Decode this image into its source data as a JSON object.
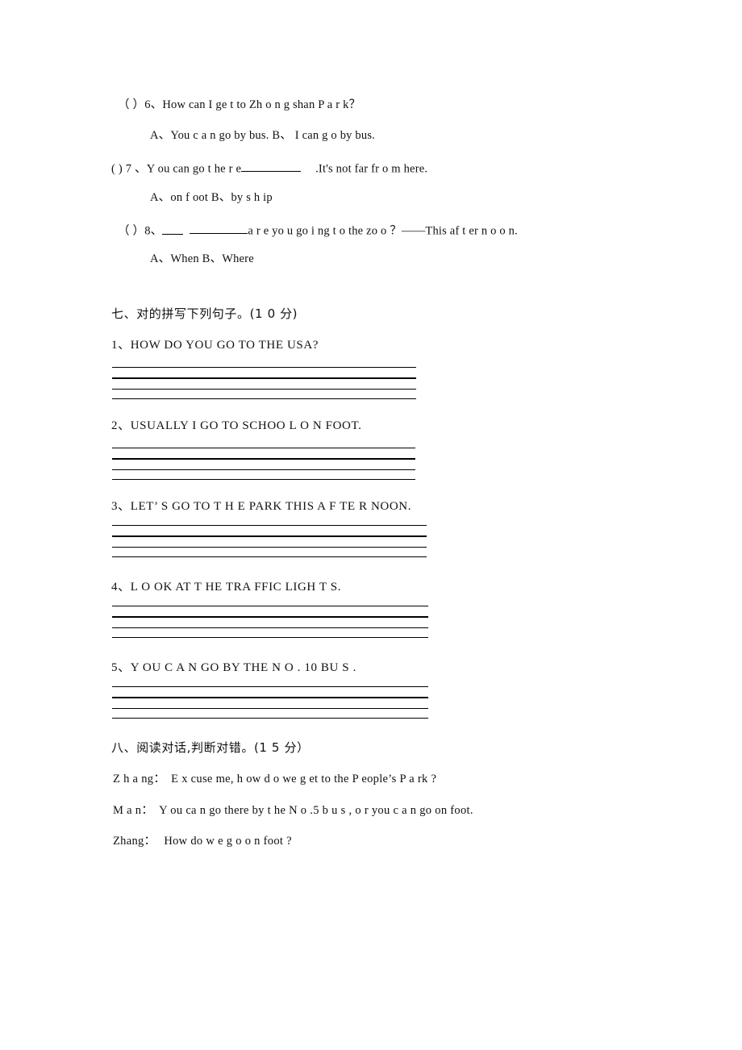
{
  "document": {
    "type": "english-exam-worksheet-page"
  },
  "multiple_choice": {
    "q6": {
      "marker": "（ ）6、",
      "stem": "How can I ge t   to Zh o n g shan  P a r  k？",
      "options": "A、You c a n go by  bus.   B、 I    can  g o   by bus."
    },
    "q7": {
      "marker": "( ) 7 、",
      "stem_before": "Y ou   can go  t he r e",
      "stem_after": ".It's not far   fr o m here.",
      "options": "A、on  f oot  B、by s h ip"
    },
    "q8": {
      "marker": "（ ）8、",
      "stem_after": "a r e yo u  go i ng  t o   the zo o ？——This  af t er n o o n.",
      "options": "A、When        B、Where"
    }
  },
  "section_seven": {
    "heading": "七、对的拼写下列句子。(1 0 分)",
    "sentences": [
      {
        "number": "1、",
        "text": "HOW   DO    YOU GO  TO   THE USA?"
      },
      {
        "number": "2、",
        "text": "USUALLY   I  GO  TO   SCHOO L  O N FOOT."
      },
      {
        "number": "3、",
        "text": "LET’ S   GO TO   T H E  PARK   THIS  A F TE R NOON."
      },
      {
        "number": "4、",
        "text": "L O OK AT  T HE TRA FFIC LIGH T S."
      },
      {
        "number": "5、",
        "text": "Y OU   C A N   GO BY THE  N O .   10 BU S ."
      }
    ]
  },
  "section_eight": {
    "heading": "八、阅读对话,判断对错。(1 5 分）",
    "dialogue": [
      {
        "speaker": "Z h  a ng：",
        "text": "E x cuse me, h ow d o   we  g et to the  P eople’s P a rk  ?"
      },
      {
        "speaker": "M a  n：",
        "text": "Y ou ca n  go there by  t he N o .5 b u  s  , o r  you  c a n   go on   foot."
      },
      {
        "speaker": "Zhang：",
        "text": "How do w e   g o  o n  foot ?"
      }
    ]
  }
}
